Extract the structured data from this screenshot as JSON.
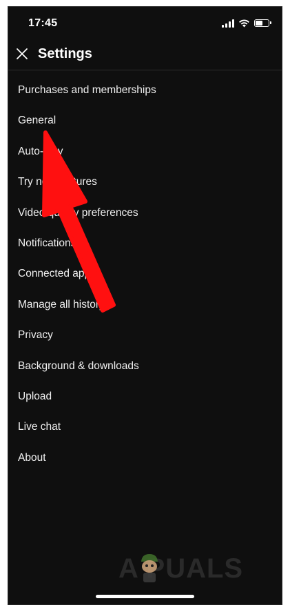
{
  "status_bar": {
    "time": "17:45",
    "battery_level": 0.6
  },
  "app_bar": {
    "title": "Settings",
    "close_icon": "close-icon"
  },
  "menu": {
    "items": [
      {
        "label": "Purchases and memberships"
      },
      {
        "label": "General"
      },
      {
        "label": "Auto-play"
      },
      {
        "label": "Try new features"
      },
      {
        "label": "Video quality preferences"
      },
      {
        "label": "Notifications"
      },
      {
        "label": "Connected apps"
      },
      {
        "label": "Manage all history"
      },
      {
        "label": "Privacy"
      },
      {
        "label": "Background & downloads"
      },
      {
        "label": "Upload"
      },
      {
        "label": "Live chat"
      },
      {
        "label": "About"
      }
    ]
  },
  "watermark": {
    "text": "A  PUALS"
  },
  "colors": {
    "background": "#0f0f0f",
    "text": "#f1f1f1",
    "arrow": "#ff1010"
  }
}
